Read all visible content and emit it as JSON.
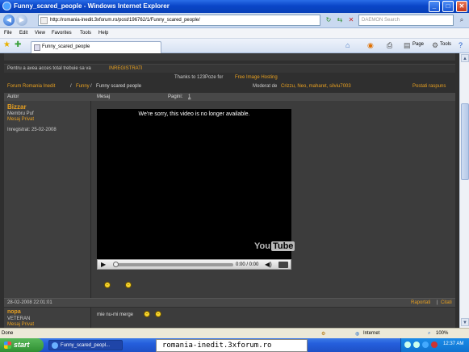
{
  "window": {
    "title": "Funny_scared_people - Windows Internet Explorer",
    "min": "_",
    "max": "□",
    "close": "✕"
  },
  "address": {
    "back": "◀",
    "forward": "▶",
    "url": "http://romania-inedit.3xforum.ro/post/196762/1/Funny_scared_people/",
    "go": "↻",
    "stop": "✕",
    "search_placeholder": "DAEMON Search",
    "search_icon": "⌕"
  },
  "menu": [
    "File",
    "Edit",
    "View",
    "Favorites",
    "Tools",
    "Help"
  ],
  "tabbar": {
    "tab_label": "Funny_scared_people",
    "page": "Page",
    "tools": "Tools",
    "help": "?"
  },
  "forum": {
    "register_prefix": "Pentru a avea acces total trebuie sa va",
    "register_link": "INREGISTRATI",
    "thanks_prefix": "Thanks to 123Poze for",
    "thanks_link": "Free Image Hosting",
    "breadcrumb": {
      "home": "Forum Romania Inedit",
      "sep": "/",
      "category": "Funny",
      "topic": "Funny scared people"
    },
    "moderators_label": "Moderat de",
    "moderators": "Crizzu, Neo, maharet, silviu7003",
    "reply": "Postati raspuns",
    "header": {
      "author": "Autor",
      "message": "Mesaj",
      "pages": "Pagini:",
      "page_num": "1"
    },
    "post1": {
      "username": "Bizzar",
      "rank": "Membru Puf",
      "pm": "Mesaj Privat",
      "registered": "Inregistrat: 25-02-2008",
      "video_msg": "We're sorry, this video is no longer available.",
      "yt_you": "You",
      "yt_tube": "Tube",
      "time": "0:00 / 0:00",
      "play": "▶",
      "vol": "◀)"
    },
    "datebar": {
      "date": "28-02-2008 22:01:01",
      "report": "Raportati",
      "sep": "|",
      "quote": "Citati"
    },
    "post2": {
      "username": "nopa",
      "rank": "VETERAN",
      "pm": "Mesaj Privat",
      "message": "mie nu-mi merge"
    }
  },
  "status": {
    "text": "Done",
    "zone": "Internet",
    "zoom": "100%"
  },
  "taskbar": {
    "start": "start",
    "task": "Funny_scared_peopl...",
    "tooltip": "romania-inedit.3xforum.ro",
    "clock": "12:37 AM"
  },
  "colors": {
    "accent_orange": "#e8a020",
    "forum_bg": "#2f2f2f",
    "xp_blue": "#245edb"
  }
}
